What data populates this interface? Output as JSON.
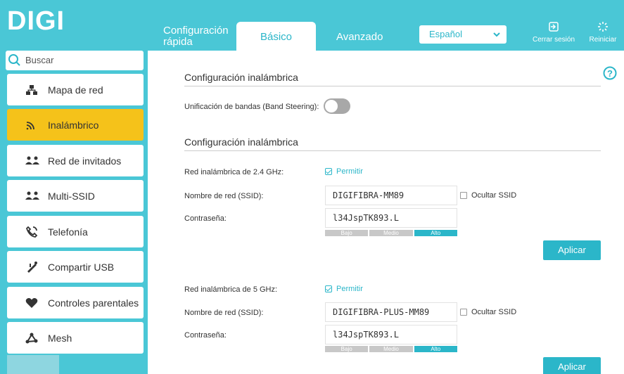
{
  "header": {
    "logo": "DIGI",
    "tabs": {
      "quick_line1": "Configuración",
      "quick_line2": "rápida",
      "basic": "Básico",
      "advanced": "Avanzado"
    },
    "language": "Español",
    "logout": "Cerrar sesión",
    "reboot": "Reiniciar"
  },
  "sidebar": {
    "search_placeholder": "Buscar",
    "items": [
      {
        "label": "Mapa de red",
        "icon": "network-map-icon"
      },
      {
        "label": "Inalámbrico",
        "icon": "wireless-icon",
        "active": true
      },
      {
        "label": "Red de invitados",
        "icon": "guest-network-icon"
      },
      {
        "label": "Multi-SSID",
        "icon": "multi-ssid-icon"
      },
      {
        "label": "Telefonía",
        "icon": "phone-icon"
      },
      {
        "label": "Compartir USB",
        "icon": "usb-icon"
      },
      {
        "label": "Controles parentales",
        "icon": "heart-icon"
      },
      {
        "label": "Mesh",
        "icon": "mesh-icon"
      }
    ]
  },
  "main": {
    "section1_title": "Configuración inalámbrica",
    "band_steering_label": "Unificación de bandas (Band Steering):",
    "band_steering_on": false,
    "section2_title": "Configuración inalámbrica",
    "net24": {
      "label": "Red inalámbrica de 2.4 GHz:",
      "enable_label": "Permitir",
      "ssid_label": "Nombre de red (SSID):",
      "ssid": "DIGIFIBRA-MM89",
      "hide_ssid": "Ocultar SSID",
      "password_label": "Contraseña:",
      "password": "l34JspTK893.L",
      "strength": [
        "Bajo",
        "Medio",
        "Alto"
      ],
      "apply": "Aplicar"
    },
    "net5": {
      "label": "Red inalámbrica de 5 GHz:",
      "enable_label": "Permitir",
      "ssid_label": "Nombre de red (SSID):",
      "ssid": "DIGIFIBRA-PLUS-MM89",
      "hide_ssid": "Ocultar SSID",
      "password_label": "Contraseña:",
      "password": "l34JspTK893.L",
      "strength": [
        "Bajo",
        "Medio",
        "Alto"
      ],
      "apply": "Aplicar"
    }
  },
  "colors": {
    "accent": "#2bb6c9",
    "header_bg": "#4ac7d6",
    "active_item": "#f5c21a"
  }
}
